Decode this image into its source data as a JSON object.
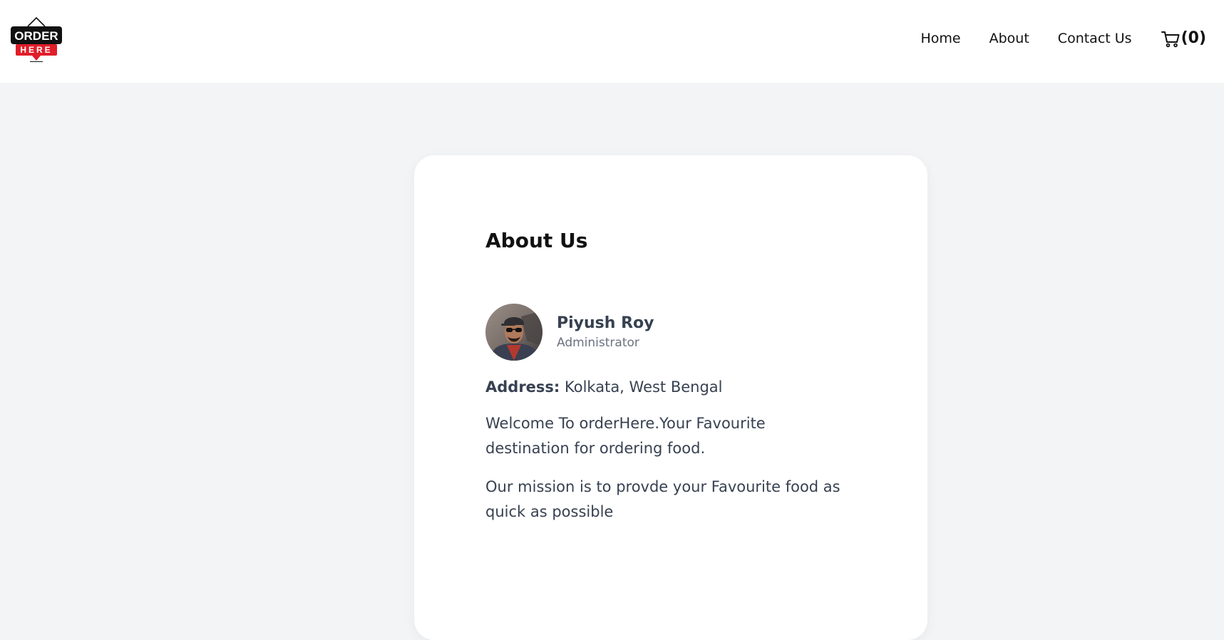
{
  "header": {
    "logo": {
      "top_text": "ORDER",
      "bottom_text": "HERE",
      "accent": "#e11d2a"
    },
    "nav": [
      {
        "label": "Home"
      },
      {
        "label": "About"
      },
      {
        "label": "Contact Us"
      }
    ],
    "cart": {
      "icon": "cart-icon",
      "count_label": "(0)"
    }
  },
  "card": {
    "title": "About Us",
    "profile": {
      "name": "Piyush Roy",
      "role": "Administrator"
    },
    "address_label": "Address:",
    "address_value": "Kolkata, West Bengal",
    "paragraphs": [
      "Welcome To orderHere.Your Favourite destination for ordering food.",
      "Our mission is to provde your Favourite food as quick as possible"
    ]
  },
  "colors": {
    "page_background": "#f3f4f6",
    "card_background": "#ffffff",
    "body_text": "#374151",
    "muted_text": "#6b7280"
  }
}
